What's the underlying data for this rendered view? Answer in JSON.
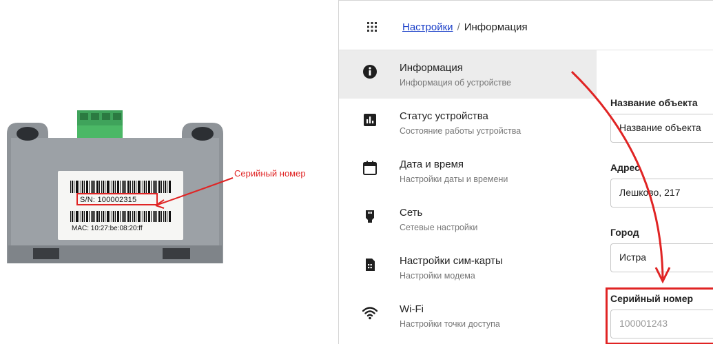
{
  "photo": {
    "serial_label": "S/N: 100002315",
    "mac_label": "MAC: 10:27:be:08:20:ff",
    "callout": "Серийный номер"
  },
  "header": {
    "breadcrumb_link": "Настройки",
    "breadcrumb_separator": "/",
    "breadcrumb_current": "Информация",
    "apps_icon": "apps-grid-icon"
  },
  "sidebar": {
    "items": [
      {
        "title": "Информация",
        "subtitle": "Информация об устройстве",
        "icon": "info-icon",
        "active": true
      },
      {
        "title": "Статус устройства",
        "subtitle": "Состояние работы устройства",
        "icon": "bar-chart-icon",
        "active": false
      },
      {
        "title": "Дата и время",
        "subtitle": "Настройки даты и времени",
        "icon": "calendar-icon",
        "active": false
      },
      {
        "title": "Сеть",
        "subtitle": "Сетевые настройки",
        "icon": "ethernet-icon",
        "active": false
      },
      {
        "title": "Настройки сим-карты",
        "subtitle": "Настройки модема",
        "icon": "sim-card-icon",
        "active": false
      },
      {
        "title": "Wi-Fi",
        "subtitle": "Настройки точки доступа",
        "icon": "wifi-icon",
        "active": false
      }
    ]
  },
  "form": {
    "object_name": {
      "label": "Название объекта",
      "value": "Название объекта"
    },
    "address": {
      "label": "Адрес",
      "value": "Лешково, 217"
    },
    "city": {
      "label": "Город",
      "value": "Истра"
    },
    "serial": {
      "label": "Серийный номер",
      "value": "100001243"
    }
  },
  "colors": {
    "accent_red": "#e02424",
    "link_blue": "#1a3fc8",
    "active_bg": "#ececec"
  }
}
